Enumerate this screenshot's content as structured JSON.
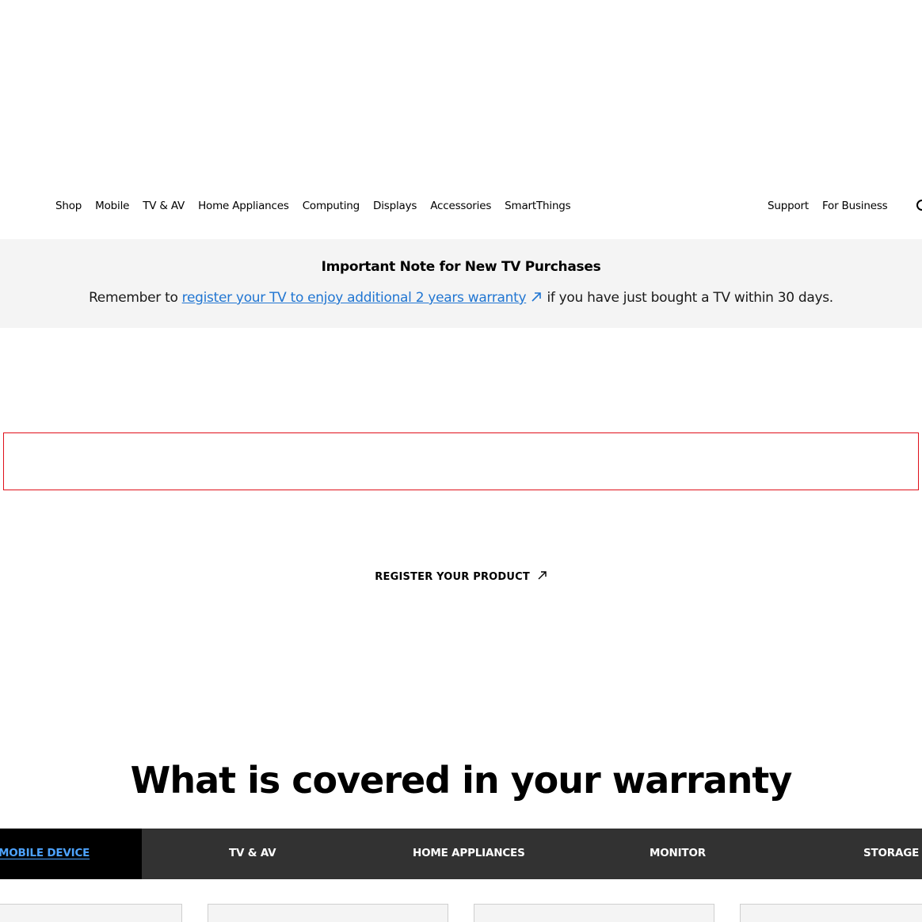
{
  "nav": {
    "left": [
      "Shop",
      "Mobile",
      "TV & AV",
      "Home Appliances",
      "Computing",
      "Displays",
      "Accessories",
      "SmartThings"
    ],
    "right": [
      "Support",
      "For Business"
    ]
  },
  "notice": {
    "title": "Important Note for New TV Purchases",
    "prefix": "Remember to ",
    "link": "register your TV to enjoy additional 2 years warranty",
    "suffix": " if you have just bought a TV within 30 days."
  },
  "register": {
    "label": "REGISTER YOUR PRODUCT"
  },
  "heading": "What is covered in your warranty",
  "tabs": [
    {
      "label": "MOBILE DEVICE",
      "active": true
    },
    {
      "label": "TV & AV",
      "active": false
    },
    {
      "label": "HOME APPLIANCES",
      "active": false
    },
    {
      "label": "MONITOR",
      "active": false
    },
    {
      "label": "STORAGE",
      "active": false
    }
  ],
  "colors": {
    "link": "#2176d2",
    "tabbar": "#323232",
    "tab_active_bg": "#000000",
    "tab_active_text": "#4da3ff",
    "frame_border": "#e0101a",
    "notice_bg": "#f4f4f4"
  }
}
